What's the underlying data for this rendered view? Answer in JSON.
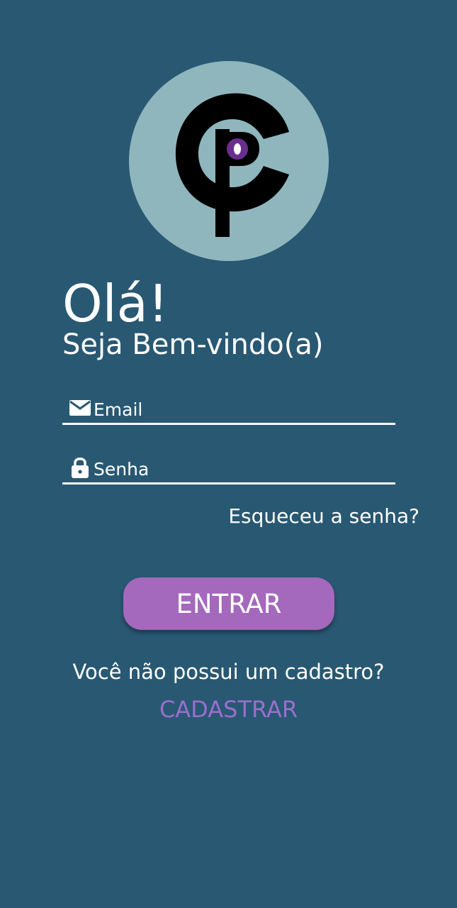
{
  "app": {
    "colors": {
      "background": "#295872",
      "logo_circle": "#8fb6bd",
      "button": "#a468bc",
      "link": "#9a6fcc",
      "text": "#ffffff"
    }
  },
  "logo": {
    "icon": "cp-logo-icon"
  },
  "header": {
    "greeting": "Olá!",
    "welcome": "Seja Bem-vindo(a)"
  },
  "form": {
    "email": {
      "icon": "envelope-icon",
      "placeholder": "Email",
      "value": ""
    },
    "password": {
      "icon": "lock-icon",
      "placeholder": "Senha",
      "value": ""
    },
    "forgot_password": "Esqueceu a senha?",
    "submit_label": "ENTRAR"
  },
  "footer": {
    "no_account_text": "Você não possui um cadastro?",
    "register_label": "CADASTRAR"
  }
}
